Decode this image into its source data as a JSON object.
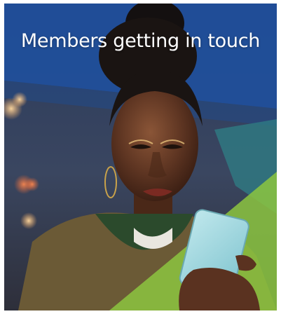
{
  "promo": {
    "headline": "Members getting in touch",
    "image_subject": "woman-reading-phone-photo",
    "colors": {
      "blue_band": "#1f4f9c",
      "green_band": "#8cc63f",
      "teal_band": "#2f7f86"
    }
  }
}
